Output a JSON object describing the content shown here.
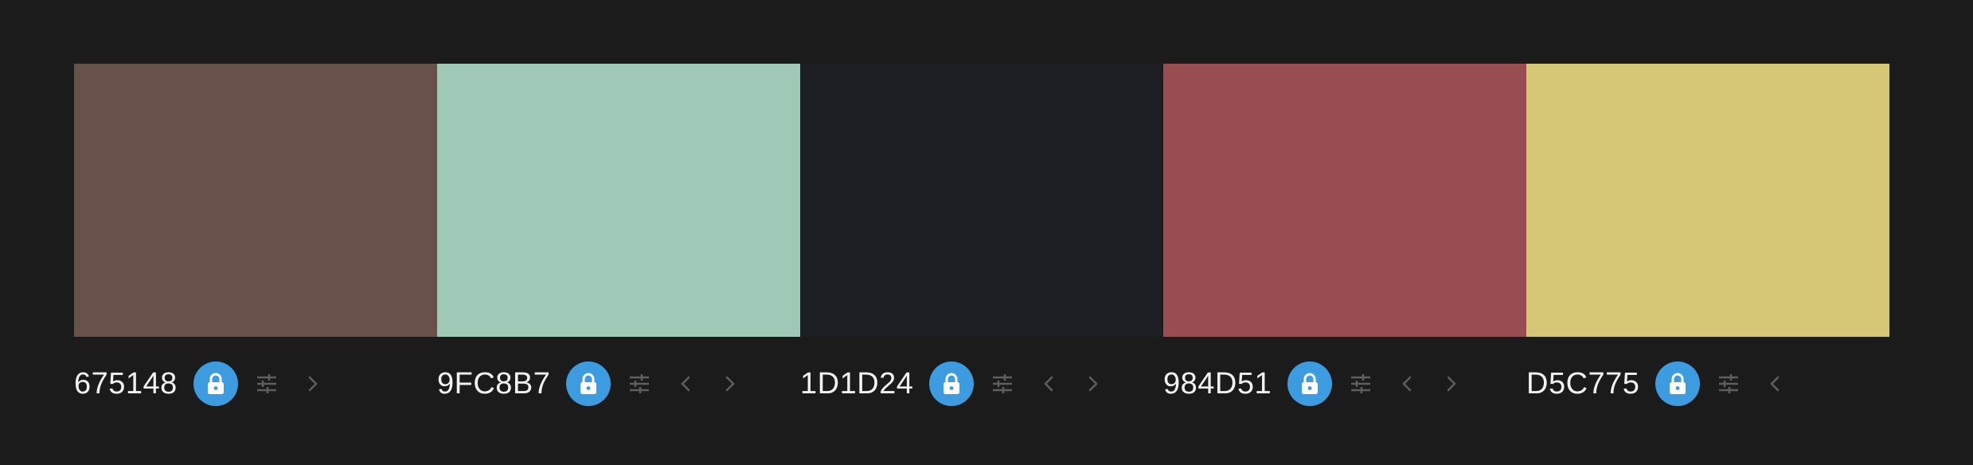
{
  "palette": {
    "swatches": [
      {
        "hex": "675148",
        "color": "#675148",
        "has_prev": false,
        "has_next": true
      },
      {
        "hex": "9FC8B7",
        "color": "#9FC8B7",
        "has_prev": true,
        "has_next": true
      },
      {
        "hex": "1D1D24",
        "color": "#1D1D24",
        "has_prev": true,
        "has_next": true
      },
      {
        "hex": "984D51",
        "color": "#984D51",
        "has_prev": true,
        "has_next": true
      },
      {
        "hex": "D5C775",
        "color": "#D5C775",
        "has_prev": true,
        "has_next": false
      }
    ]
  },
  "icons": {
    "lock": "lock-icon",
    "adjust": "sliders-icon",
    "prev": "chevron-left-icon",
    "next": "chevron-right-icon"
  },
  "theme": {
    "background": "#1b1b1c",
    "accent": "#3d9be0",
    "icon_muted": "#5e5e60",
    "text": "#f2f2f2"
  }
}
